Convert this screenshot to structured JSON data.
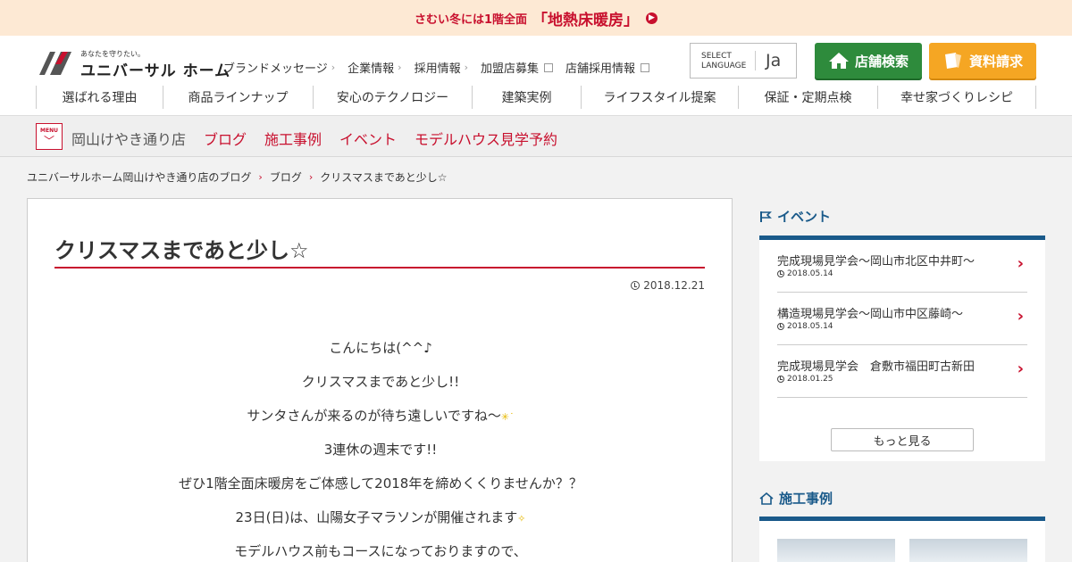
{
  "banner": {
    "prefix": "さむい冬には1階全面",
    "highlight": "「地熱床暖房」"
  },
  "logo": {
    "tagline": "あなたを守りたい。",
    "name": "ユニバーサル ホーム"
  },
  "topnav": [
    {
      "label": "ブランドメッセージ",
      "icon": "chevron"
    },
    {
      "label": "企業情報",
      "icon": "chevron"
    },
    {
      "label": "採用情報",
      "icon": "chevron"
    },
    {
      "label": "加盟店募集",
      "icon": "external"
    },
    {
      "label": "店舗採用情報",
      "icon": "external"
    }
  ],
  "language": {
    "label": "SELECT\nLANGUAGE",
    "value": "Ja"
  },
  "buttons": {
    "store_search": "店舗検索",
    "request_docs": "資料請求"
  },
  "mainnav": [
    "選ばれる理由",
    "商品ラインナップ",
    "安心のテクノロジー",
    "建築実例",
    "ライフスタイル提案",
    "保証・定期点検",
    "幸せ家づくりレシピ"
  ],
  "storebar": {
    "menu_label": "MENU",
    "store_name": "岡山けやき通り店",
    "links": [
      "ブログ",
      "施工事例",
      "イベント",
      "モデルハウス見学予約"
    ]
  },
  "breadcrumb": [
    "ユニバーサルホーム岡山けやき通り店のブログ",
    "ブログ",
    "クリスマスまであと少し☆"
  ],
  "article": {
    "title": "クリスマスまであと少し☆",
    "date": "2018.12.21",
    "lines": [
      "こんにちは(^^♪",
      "クリスマスまであと少し!!",
      "サンタさんが来るのが待ち遠しいですね～",
      "3連休の週末です!!",
      "ぜひ1階全面床暖房をご体感して2018年を締めくくりませんか？？",
      "23日(日)は、山陽女子マラソンが開催されます",
      "モデルハウス前もコースになっておりますので、"
    ]
  },
  "sidebar": {
    "events_title": "イベント",
    "events": [
      {
        "title": "完成現場見学会～岡山市北区中井町～",
        "date": "2018.05.14"
      },
      {
        "title": "構造現場見学会～岡山市中区藤崎～",
        "date": "2018.05.14"
      },
      {
        "title": "完成現場見学会　倉敷市福田町古新田",
        "date": "2018.01.25"
      }
    ],
    "more_label": "もっと見る",
    "works_title": "施工事例"
  },
  "colors": {
    "brand_red": "#c8102e",
    "green": "#2e8b3c",
    "orange": "#f5a623",
    "navy": "#1a5a8a"
  }
}
